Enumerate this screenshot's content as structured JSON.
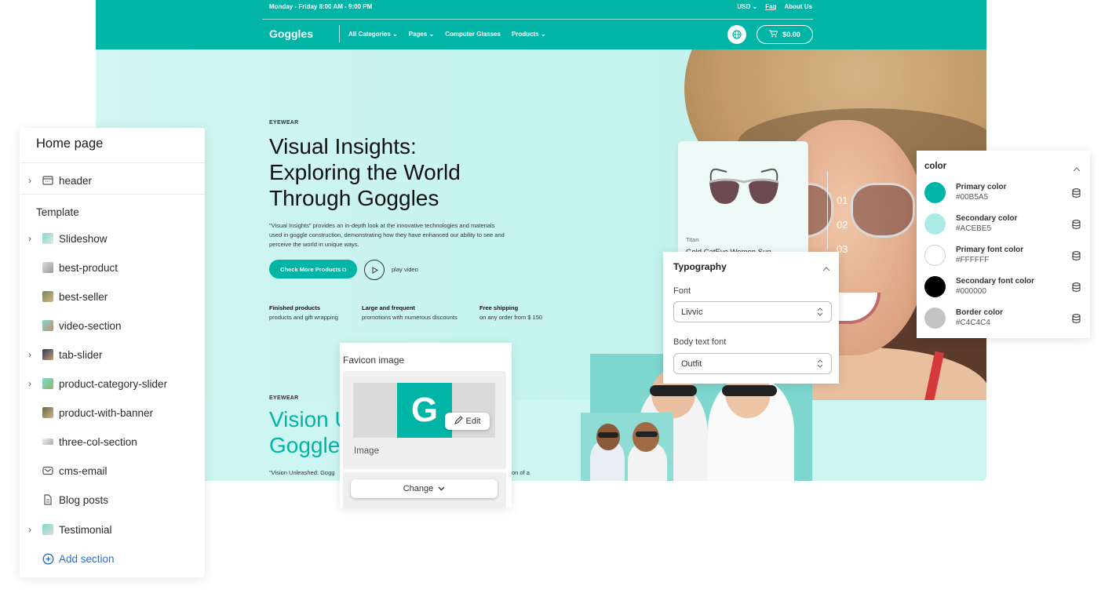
{
  "store": {
    "hours": "Monday - Friday  8:00 AM - 9:00 PM",
    "currency": "USD",
    "faq": "Faq",
    "about": "About Us",
    "logo": "Goggles",
    "nav": [
      "All Categories",
      "Pages",
      "Computer Glasses",
      "Products"
    ],
    "cart_total": "$0.00",
    "hero": {
      "eyebrow": "EYEWEAR",
      "title_lines": [
        "Visual Insights:",
        "Exploring the World",
        "Through Goggles"
      ],
      "description": "\"Visual Insights\" provides an in-depth look at the innovative technologies and materials used in goggle construction, demonstrating how they have enhanced our ability to see and perceive the world in unique ways.",
      "cta": "Check More Products",
      "play_label": "play video",
      "features": [
        {
          "title": "Finished products",
          "text": "products and gift wrapping"
        },
        {
          "title": "Large and frequent",
          "text": "promotions with numerous discounts"
        },
        {
          "title": "Free shipping",
          "text": "on any order from $ 150"
        }
      ],
      "slide_numbers": [
        "01",
        "02",
        "03"
      ]
    },
    "product_card": {
      "brand": "Titan",
      "name": "Gold CatEye Women Sun"
    },
    "second_section": {
      "eyebrow": "EYEWEAR",
      "title_lines": [
        "Vision U",
        "Goggle"
      ],
      "description": "\"Vision Unleashed: Gogg",
      "description_tail": "on of a"
    }
  },
  "left_panel": {
    "title": "Home page",
    "header_item": "header",
    "section_label": "Template",
    "items": [
      {
        "label": "Slideshow",
        "expandable": true
      },
      {
        "label": "best-product",
        "expandable": false
      },
      {
        "label": "best-seller",
        "expandable": false
      },
      {
        "label": "video-section",
        "expandable": false
      },
      {
        "label": "tab-slider",
        "expandable": true
      },
      {
        "label": "product-category-slider",
        "expandable": true
      },
      {
        "label": "product-with-banner",
        "expandable": false
      },
      {
        "label": "three-col-section",
        "expandable": false
      },
      {
        "label": "cms-email",
        "expandable": false
      },
      {
        "label": "Blog posts",
        "expandable": false
      },
      {
        "label": "Testimonial",
        "expandable": true
      }
    ],
    "add_section": "Add section"
  },
  "favicon": {
    "title": "Favicon image",
    "letter": "G",
    "edit": "Edit",
    "image_label": "Image",
    "change": "Change"
  },
  "typography": {
    "title": "Typography",
    "font_label": "Font",
    "font_value": "Livvic",
    "body_label": "Body text font",
    "body_value": "Outfit"
  },
  "colors": {
    "title": "color",
    "items": [
      {
        "name": "Primary color",
        "hex": "#00B5A5"
      },
      {
        "name": "Secondary color",
        "hex": "#ACEBE5"
      },
      {
        "name": "Primary font color",
        "hex": "#FFFFFF"
      },
      {
        "name": "Secondary font color",
        "hex": "#000000"
      },
      {
        "name": "Border color",
        "hex": "#C4C4C4"
      }
    ]
  },
  "theme": {
    "accent": "#00B5A5",
    "link": "#2C6ECB"
  }
}
